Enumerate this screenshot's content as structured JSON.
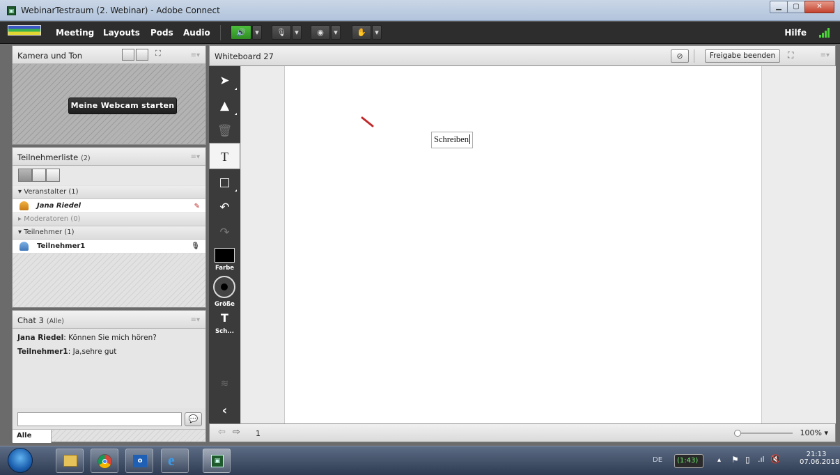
{
  "window": {
    "title": "WebinarTestraum (2. Webinar) - Adobe Connect",
    "controls": [
      "minimize",
      "maximize",
      "close"
    ]
  },
  "menubar": {
    "items": [
      "Meeting",
      "Layouts",
      "Pods",
      "Audio"
    ],
    "help": "Hilfe",
    "tools": [
      "speaker-icon",
      "microphone-icon",
      "camera-icon",
      "raise-hand-icon"
    ]
  },
  "camera_pod": {
    "title": "Kamera und Ton",
    "start_button": "Meine Webcam starten"
  },
  "attendee_pod": {
    "title": "Teilnehmerliste",
    "count": "(2)",
    "sections": [
      {
        "label": "Veranstalter (1)",
        "expanded": true,
        "users": [
          {
            "name": "Jana Riedel",
            "italic": true
          }
        ]
      },
      {
        "label": "Moderatoren (0)",
        "expanded": false,
        "users": []
      },
      {
        "label": "Teilnehmer (1)",
        "expanded": true,
        "users": [
          {
            "name": "Teilnehmer1",
            "italic": false
          }
        ]
      }
    ]
  },
  "chat_pod": {
    "title": "Chat 3",
    "scope": "(Alle)",
    "messages": [
      {
        "sender": "Jana Riedel",
        "text": ": Können Sie mich hören?"
      },
      {
        "sender": "Teilnehmer1",
        "text": ": Ja,sehre gut"
      }
    ],
    "input_value": "",
    "recipient_tab": "Alle"
  },
  "whiteboard": {
    "title": "Whiteboard 27",
    "stop_share": "Freigabe beenden",
    "tools": [
      "select-tool",
      "pen-tool",
      "delete-tool",
      "text-tool",
      "shape-tool",
      "undo-tool",
      "redo-tool"
    ],
    "color_label": "Farbe",
    "size_label": "Größe",
    "font_label": "Sch...",
    "text_box": "Schreiben",
    "page_number": "1",
    "zoom": "100%",
    "zoom_level": 0.1
  },
  "taskbar": {
    "lang": "DE",
    "battery": "(1:43)",
    "time": "21:13",
    "date": "07.06.2018",
    "apps": [
      "file-explorer",
      "chrome",
      "outlook",
      "internet-explorer",
      "adobe-connect"
    ]
  },
  "colors": {
    "accent_green": "#4cbf3c",
    "toolbar_dark": "#3b3b3b",
    "pen_stroke": "#c0282a"
  }
}
